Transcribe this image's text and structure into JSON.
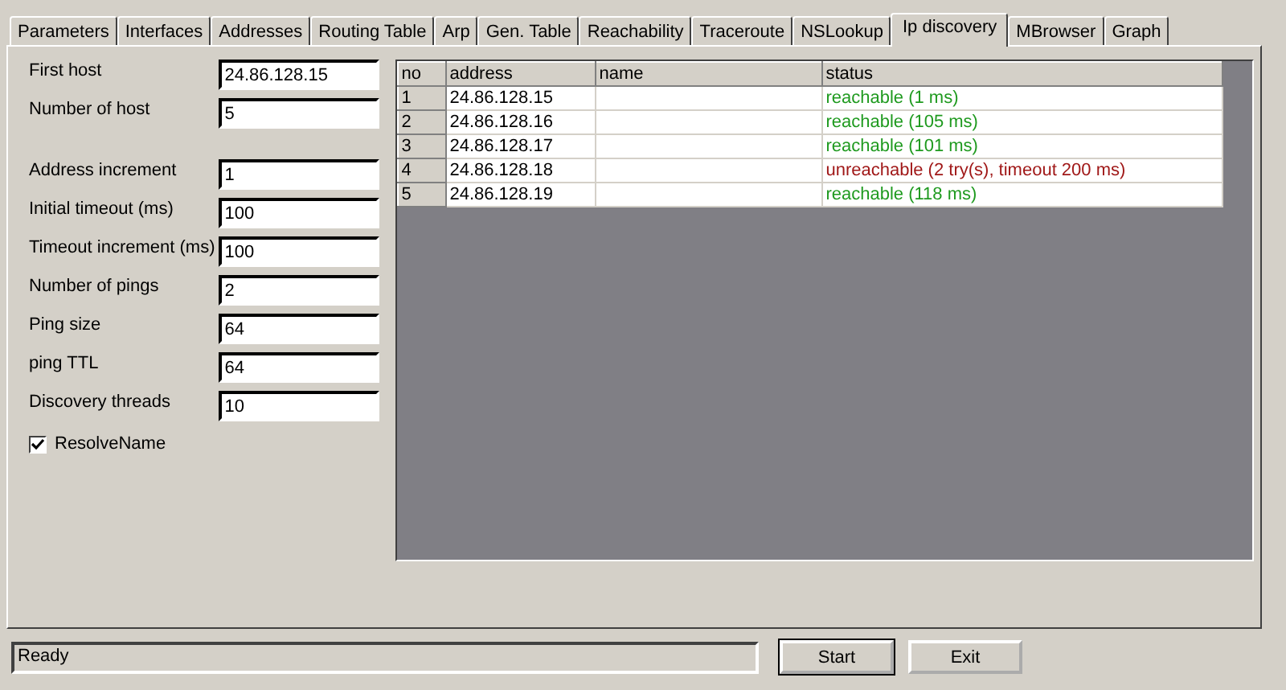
{
  "tabs": [
    {
      "label": "Parameters",
      "selected": false
    },
    {
      "label": "Interfaces",
      "selected": false
    },
    {
      "label": "Addresses",
      "selected": false
    },
    {
      "label": "Routing Table",
      "selected": false
    },
    {
      "label": "Arp",
      "selected": false
    },
    {
      "label": "Gen. Table",
      "selected": false
    },
    {
      "label": "Reachability",
      "selected": false
    },
    {
      "label": "Traceroute",
      "selected": false
    },
    {
      "label": "NSLookup",
      "selected": false
    },
    {
      "label": "Ip discovery",
      "selected": true
    },
    {
      "label": "MBrowser",
      "selected": false
    },
    {
      "label": "Graph",
      "selected": false
    }
  ],
  "host_fields": [
    {
      "label": "First host",
      "value": "24.86.128.15"
    },
    {
      "label": "Number of host",
      "value": "5"
    }
  ],
  "option_fields": [
    {
      "label": "Address increment",
      "value": "1"
    },
    {
      "label": "Initial timeout (ms)",
      "value": "100"
    },
    {
      "label": "Timeout increment (ms)",
      "value": "100"
    },
    {
      "label": "Number of pings",
      "value": "2"
    },
    {
      "label": "Ping size",
      "value": "64"
    },
    {
      "label": "ping TTL",
      "value": "64"
    },
    {
      "label": "Discovery threads",
      "value": "10"
    }
  ],
  "resolve_name": {
    "label": "ResolveName",
    "checked": true
  },
  "table": {
    "columns": [
      "no",
      "address",
      "name",
      "status"
    ],
    "rows": [
      {
        "no": "1",
        "address": "24.86.128.15",
        "status": "reachable (1 ms)",
        "reachable": true
      },
      {
        "no": "2",
        "address": "24.86.128.16",
        "status": "reachable (105 ms)",
        "reachable": true
      },
      {
        "no": "3",
        "address": "24.86.128.17",
        "status": "reachable (101 ms)",
        "reachable": true
      },
      {
        "no": "4",
        "address": "24.86.128.18",
        "status": "unreachable (2 try(s), timeout 200 ms)",
        "reachable": false
      },
      {
        "no": "5",
        "address": "24.86.128.19",
        "status": "reachable (118 ms)",
        "reachable": true
      }
    ]
  },
  "status_bar": "Ready",
  "buttons": [
    "Start",
    "Exit"
  ]
}
